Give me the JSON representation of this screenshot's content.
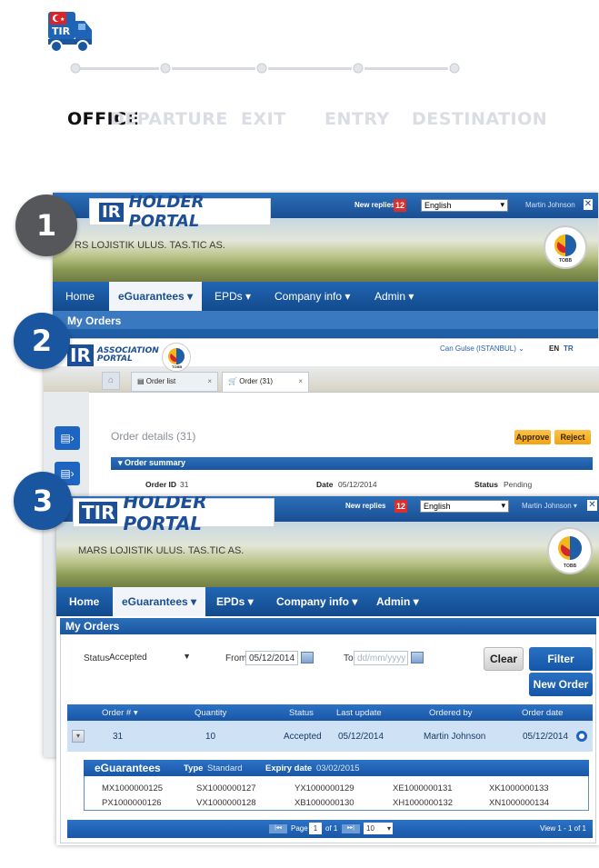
{
  "stages": {
    "office": "OFFICE",
    "departure": "DEPARTURE",
    "exit": "EXIT",
    "entry": "ENTRY",
    "destination": "DESTINATION"
  },
  "truck": {
    "label": "TIR"
  },
  "badges": {
    "one": "1",
    "two": "2",
    "three": "3"
  },
  "shot1": {
    "portal_title": "HOLDER PORTAL",
    "tir": "IR",
    "new_replies": "New replies",
    "replies_count": "12",
    "language": "English",
    "user": "Martin Johnson",
    "company": "RS LOJISTIK ULUS. TAS.TIC AS.",
    "logo_caption": "TOBB",
    "nav": {
      "home": "Home",
      "eguarantees": "eGuarantees",
      "epds": "EPDs",
      "company_info": "Company info",
      "admin": "Admin"
    },
    "sub": "My Orders"
  },
  "shot2": {
    "portal_title": "ASSOCIATION PORTAL",
    "tir": "IR",
    "logo_caption": "TOBB",
    "user": "Can Gulse (ISTANBUL)",
    "lang_en": "EN",
    "lang_tr": "TR",
    "tabs": {
      "order_list": "Order list",
      "order": "Order (31)"
    },
    "order_details": "Order details (31)",
    "approve": "Approve",
    "reject": "Reject",
    "order_summary": "Order summary",
    "fields": {
      "order_id_label": "Order ID",
      "order_id": "31",
      "date_label": "Date",
      "date": "05/12/2014",
      "status_label": "Status",
      "status": "Pending"
    }
  },
  "shot3": {
    "portal_title": "HOLDER PORTAL",
    "tir": "TIR",
    "new_replies": "New replies",
    "replies_count": "12",
    "language": "English",
    "user": "Martin Johnson",
    "company": "MARS LOJISTIK ULUS. TAS.TIC AS.",
    "logo_caption": "TOBB",
    "nav": {
      "home": "Home",
      "eguarantees": "eGuarantees",
      "epds": "EPDs",
      "company_info": "Company info",
      "admin": "Admin"
    },
    "section": "My Orders",
    "filters": {
      "status_label": "Status",
      "status_value": "Accepted",
      "from_label": "From",
      "from_value": "05/12/2014",
      "to_label": "To",
      "to_placeholder": "dd/mm/yyyy"
    },
    "buttons": {
      "clear": "Clear",
      "filter": "Filter",
      "new_order": "New Order"
    },
    "table": {
      "headers": [
        "Order #",
        "Quantity",
        "Status",
        "Last update",
        "Ordered by",
        "Order date"
      ],
      "row": [
        "31",
        "10",
        "Accepted",
        "05/12/2014",
        "Martin Johnson",
        "05/12/2014"
      ]
    },
    "eguarantees": {
      "title": "eGuarantees",
      "type_label": "Type",
      "type_value": "Standard",
      "expiry_label": "Expiry date",
      "expiry_value": "03/02/2015",
      "rows": [
        [
          "MX1000000125",
          "SX1000000127",
          "YX1000000129",
          "XE1000000131",
          "XK1000000133"
        ],
        [
          "PX1000000126",
          "VX1000000128",
          "XB1000000130",
          "XH1000000132",
          "XN1000000134"
        ]
      ]
    },
    "pager": {
      "page": "Page",
      "page_num": "1",
      "of": "of 1",
      "per_page": "10",
      "view": "View 1 - 1 of 1"
    }
  }
}
